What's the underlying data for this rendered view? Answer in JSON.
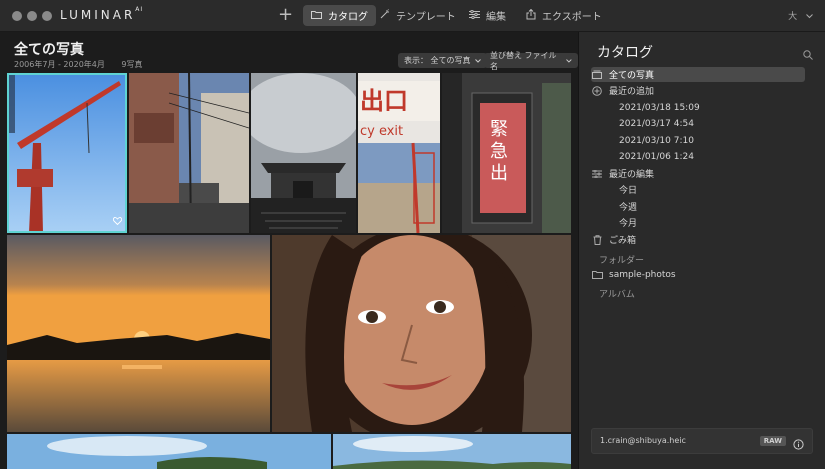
{
  "app": {
    "logo": "LUMINAR",
    "logo_sup": "AI"
  },
  "toolbar": {
    "add": "+",
    "tabs": [
      {
        "label": "カタログ"
      },
      {
        "label": "テンプレート"
      },
      {
        "label": "編集"
      },
      {
        "label": "エクスポート"
      }
    ],
    "size_label": "大"
  },
  "main": {
    "title": "全ての写真",
    "date_range": "2006年7月 - 2020年4月",
    "photo_count": "9写真",
    "view_label": "表示： 全ての写真",
    "sort_label": "並び替え ファイル名",
    "photo_names": [
      "crane",
      "alley",
      "gate",
      "exit-sign",
      "emergency-exit",
      "sunset",
      "portrait",
      "sky-1",
      "sky-2"
    ]
  },
  "panel": {
    "title": "カタログ",
    "all_photos": "全ての写真",
    "recent_added": "最近の追加",
    "dates": [
      "2021/03/18 15:09",
      "2021/03/17 4:54",
      "2021/03/10 7:10",
      "2021/01/06 1:24"
    ],
    "recent_edits": "最近の編集",
    "today": "今日",
    "this_week": "今週",
    "this_month": "今月",
    "trash": "ごみ箱",
    "folders_label": "フォルダー",
    "folder": "sample-photos",
    "albums_label": "アルバム"
  },
  "file": {
    "name": "1.crain@shibuya.heic",
    "badge": "RAW"
  },
  "colors": {
    "accent": "#5fd3d3",
    "panel": "#2a2a2a",
    "titlebar": "#2b2b2b"
  }
}
